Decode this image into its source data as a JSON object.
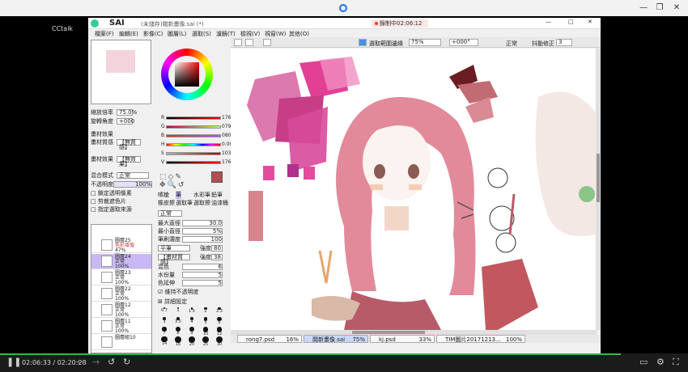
{
  "outer": {
    "window_controls": [
      "—",
      "❐",
      "✕"
    ],
    "left_label": "CCtalk"
  },
  "sai": {
    "logo": "SAI",
    "filename": "(未儲存)閱新畫像.sai (*)",
    "recording": "錄制中02:06:12",
    "controls": [
      "—",
      "□",
      "✕"
    ],
    "menu": [
      "檔案(F)",
      "編輯(E)",
      "影像(C)",
      "圖層(L)",
      "選取(S)",
      "濾鏡(T)",
      "檢視(V)",
      "視窗(W)",
      "其他(O)"
    ],
    "toolbar": {
      "checkbox": "選取範圍邊緣",
      "zoom": "75%",
      "angle": "+000°",
      "mode": "正常",
      "stab_label": "抖動修正",
      "stab": "3"
    },
    "nav": {
      "zoom_label": "縮放倍率",
      "zoom": "75.0%",
      "angle_label": "旋轉角度",
      "angle": "+000"
    },
    "ctx": {
      "paper_title": "畫材效果",
      "paper1_label": "畫材質感",
      "paper1": "【無質感】",
      "paper2_label": "畫材效果",
      "paper2": "【無效果】",
      "blend_label": "混合模式",
      "blend": "正常",
      "opacity_label": "不透明度",
      "opacity": "100%",
      "checks": [
        "鎖定透明像素",
        "剪裁遮色片",
        "指定選取來源"
      ]
    },
    "color": {
      "sliders": [
        {
          "l": "R",
          "v": "176"
        },
        {
          "l": "G",
          "v": "079"
        },
        {
          "l": "B",
          "v": "080"
        },
        {
          "l": "H",
          "v": "0.00"
        },
        {
          "l": "S",
          "v": "103"
        },
        {
          "l": "V",
          "v": "176"
        }
      ]
    },
    "brush": {
      "tools": [
        "噴槍",
        "筆",
        "水彩筆",
        "鉛筆",
        "橡皮擦",
        "選取筆",
        "選取擦",
        "油漆桶"
      ],
      "mode": "正常",
      "max_label": "最大直徑",
      "max": "30.0",
      "min_label": "最小直徑",
      "min": "5%",
      "density_label": "筆刷濃度",
      "density": "100",
      "shape": "平筆",
      "shape_strength_label": "強度",
      "shape_strength": "80",
      "texture": "【畫材質感】",
      "texture_strength_label": "強度",
      "texture_strength": "38",
      "blend_label": "混色",
      "blend": "6",
      "water_label": "水份量",
      "water": "5",
      "keep_label": "色延伸",
      "keep": "5",
      "keep_opacity": "維持不透明度",
      "detail": "詳細設定",
      "sizes": [
        "0.7",
        "1",
        "1.5",
        "2",
        "2.3",
        "3",
        "3.5",
        "4",
        "5",
        "6",
        "7",
        "8",
        "9",
        "10",
        "12",
        "14",
        "16",
        "20",
        "25",
        "30"
      ]
    },
    "layers": [
      {
        "name": "圖層25",
        "mode": "色彩增值",
        "op": "47%",
        "sel": false
      },
      {
        "name": "圖層24",
        "mode": "正常",
        "op": "100%",
        "sel": true
      },
      {
        "name": "圖層23",
        "mode": "正常",
        "op": "100%",
        "sel": false
      },
      {
        "name": "圖層22",
        "mode": "正常",
        "op": "100%",
        "sel": false
      },
      {
        "name": "圖層12",
        "mode": "正常",
        "op": "100%",
        "sel": false
      },
      {
        "name": "圖層11",
        "mode": "正常",
        "op": "100%",
        "sel": false
      },
      {
        "name": "圖層組10",
        "mode": "",
        "op": "",
        "sel": false
      }
    ],
    "tabs": [
      {
        "name": "rong7.psd",
        "z": "16%"
      },
      {
        "name": "閱新畫像.sai",
        "z": "75%"
      },
      {
        "name": "kj.psd",
        "z": "33%"
      },
      {
        "name": "TIM圖片20171213...",
        "z": "100%"
      }
    ]
  },
  "player": {
    "time": "02:06:33 / 02:20:28"
  },
  "colors": {
    "accent": "#3ab54a",
    "selected_layer": "#c9b8f3",
    "primary_color": "#b04f50"
  }
}
